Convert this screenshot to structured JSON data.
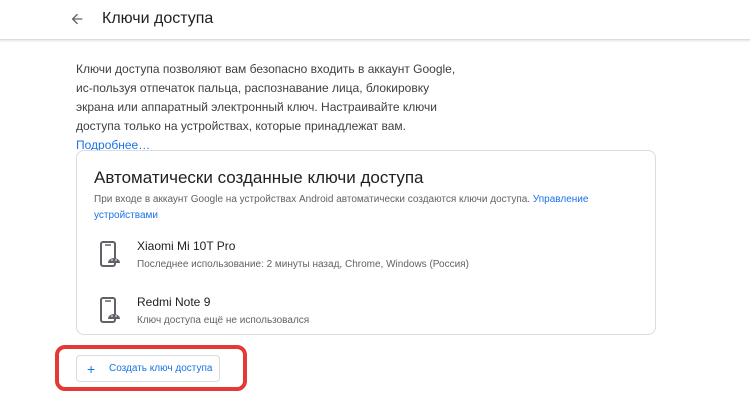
{
  "header": {
    "title": "Ключи доступа",
    "back_icon": "arrow-back-icon"
  },
  "intro": {
    "text": "Ключи доступа позволяют вам безопасно входить в аккаунт Google, ис-пользуя отпечаток пальца, распознавание лица, блокировку экрана или аппаратный электронный ключ. Настраивайте ключи доступа только на устройствах, которые принадлежат вам.",
    "link": "Подробнее…"
  },
  "card": {
    "title": "Автоматически созданные ключи доступа",
    "description": "При входе в аккаунт Google на устройствах Android автоматически создаются ключи доступа.",
    "link": "Управление устройствами",
    "devices": [
      {
        "name": "Xiaomi Mi 10T Pro",
        "detail": "Последнее использование: 2 минуты назад, Chrome, Windows (Россия)",
        "icon": "android-phone-icon"
      },
      {
        "name": "Redmi Note 9",
        "detail": "Ключ доступа ещё не использовался",
        "icon": "android-phone-icon"
      }
    ]
  },
  "create_button": {
    "label": "Создать ключ доступа",
    "icon": "plus-icon"
  },
  "colors": {
    "accent": "#1a73e8",
    "highlight": "#e53935",
    "border": "#dadce0"
  }
}
